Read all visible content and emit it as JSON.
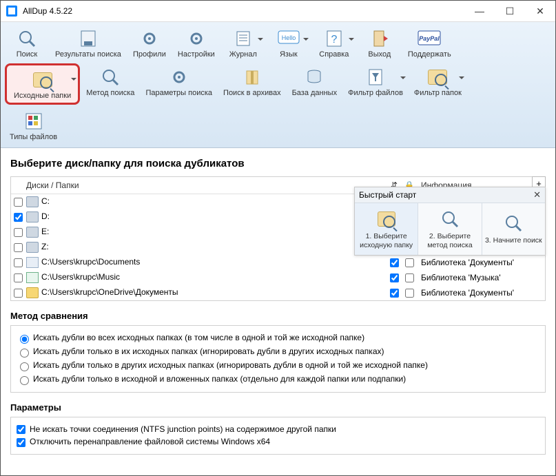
{
  "window": {
    "title": "AllDup 4.5.22"
  },
  "toolbar1": [
    {
      "name": "search",
      "label": "Поиск",
      "icon": "magnifier"
    },
    {
      "name": "results",
      "label": "Результаты поиска",
      "icon": "floppy"
    },
    {
      "name": "profiles",
      "label": "Профили",
      "icon": "gear"
    },
    {
      "name": "settings",
      "label": "Настройки",
      "icon": "gears"
    },
    {
      "name": "journal",
      "label": "Журнал",
      "icon": "list",
      "drop": true
    },
    {
      "name": "language",
      "label": "Язык",
      "icon": "hello",
      "drop": true
    },
    {
      "name": "help",
      "label": "Справка",
      "icon": "question",
      "drop": true
    },
    {
      "name": "exit",
      "label": "Выход",
      "icon": "door"
    },
    {
      "name": "donate",
      "label": "Поддержать",
      "icon": "paypal"
    }
  ],
  "toolbar2": [
    {
      "name": "source-folders",
      "label": "Исходные папки",
      "drop": true,
      "highlight": true
    },
    {
      "name": "search-method",
      "label": "Метод поиска"
    },
    {
      "name": "search-params",
      "label": "Параметры поиска"
    },
    {
      "name": "archive-search",
      "label": "Поиск в архивах"
    },
    {
      "name": "database",
      "label": "База данных"
    },
    {
      "name": "file-filter",
      "label": "Фильтр файлов",
      "drop": true
    },
    {
      "name": "folder-filter",
      "label": "Фильтр папок",
      "drop": true
    }
  ],
  "toolbar3": [
    {
      "name": "file-types",
      "label": "Типы файлов"
    }
  ],
  "main": {
    "heading": "Выберите диск/папку для поиска дубликатов",
    "cols": {
      "disks": "Диски / Папки",
      "info": "Информация"
    },
    "rows": [
      {
        "sel": false,
        "icon": "drive",
        "name": "C:",
        "c1": true,
        "c2": false,
        "info": ""
      },
      {
        "sel": true,
        "icon": "drive",
        "name": "D:",
        "c1": true,
        "c2": false,
        "info": ""
      },
      {
        "sel": false,
        "icon": "drive",
        "name": "E:",
        "c1": true,
        "c2": false,
        "info": ""
      },
      {
        "sel": false,
        "icon": "drive",
        "name": "Z:",
        "c1": true,
        "c2": false,
        "info": ""
      },
      {
        "sel": false,
        "icon": "docs",
        "name": "C:\\Users\\krupc\\Documents",
        "c1": true,
        "c2": false,
        "info": "Библиотека 'Документы'"
      },
      {
        "sel": false,
        "icon": "music",
        "name": "C:\\Users\\krupc\\Music",
        "c1": true,
        "c2": false,
        "info": "Библиотека 'Музыка'"
      },
      {
        "sel": false,
        "icon": "folder",
        "name": "C:\\Users\\krupc\\OneDrive\\Документы",
        "c1": true,
        "c2": false,
        "info": "Библиотека 'Документы'"
      }
    ],
    "quickstart": {
      "title": "Быстрый старт",
      "steps": [
        {
          "label": "1. Выберите исходную папку"
        },
        {
          "label": "2. Выберите метод поиска"
        },
        {
          "label": "3. Начните поиск"
        }
      ]
    },
    "method": {
      "heading": "Метод сравнения",
      "options": [
        "Искать дубли во всех исходных папках (в том числе в одной и той же исходной папке)",
        "Искать дубли только в их исходных папках (игнорировать дубли в других исходных папках)",
        "Искать дубли только в других исходных папках (игнорировать дубли в одной и той же исходной папке)",
        "Искать дубли только в исходной и вложенных папках (отдельно для каждой папки или подпапки)"
      ],
      "selected": 0
    },
    "params": {
      "heading": "Параметры",
      "options": [
        {
          "label": "Не искать точки соединения (NTFS junction points) на содержимое другой папки",
          "checked": true
        },
        {
          "label": "Отключить перенаправление файловой системы Windows x64",
          "checked": true
        }
      ]
    }
  }
}
